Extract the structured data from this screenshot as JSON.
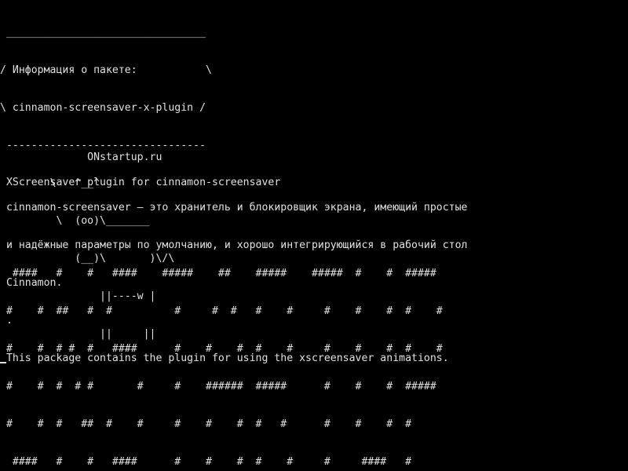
{
  "colors": {
    "background": "#000000",
    "text": "#e0e0e0"
  },
  "cowsay": {
    "bubble_top": " ________________________________",
    "bubble_line1": "/ Информация о пакете:           \\",
    "bubble_line2": "\\ cinnamon-screensaver-x-plugin /",
    "bubble_bottom": " --------------------------------",
    "cow_line1": "        \\   ^__^",
    "cow_line2": "         \\  (oo)\\_______",
    "cow_line3": "            (__)\\       )\\/\\",
    "cow_line4": "                ||----w |",
    "cow_line5": "                ||     ||"
  },
  "site": {
    "label": "              ONstartup.ru"
  },
  "package": {
    "summary": " XScreensaver plugin for cinnamon-screensaver",
    "desc_line1": " cinnamon-screensaver — это хранитель и блокировщик экрана, имеющий простые",
    "desc_line2": " и надёжные параметры по умолчанию, и хорошо интегрирующийся в рабочий стол",
    "desc_line3": " Cinnamon.",
    "desc_dot": " .",
    "desc_line4": " This package contains the plugin for using the xscreensaver animations."
  },
  "banner": {
    "line1": "  ####   #    #   ####    #####    ##    #####    #####  #    #  #####",
    "line2": " #    #  ##   #  #          #     #  #   #    #     #    #    #  #    #",
    "line3": " #    #  # #  #   ####      #    #    #  #    #     #    #    #  #    #",
    "line4": " #    #  #  # #       #     #    ######  #####      #    #    #  #####",
    "line5": " #    #  #   ##  #    #     #    #    #  #   #      #    #    #  #",
    "line6": "  ####   #    #   ####      #    #    #  #    #     #     ####   #"
  }
}
